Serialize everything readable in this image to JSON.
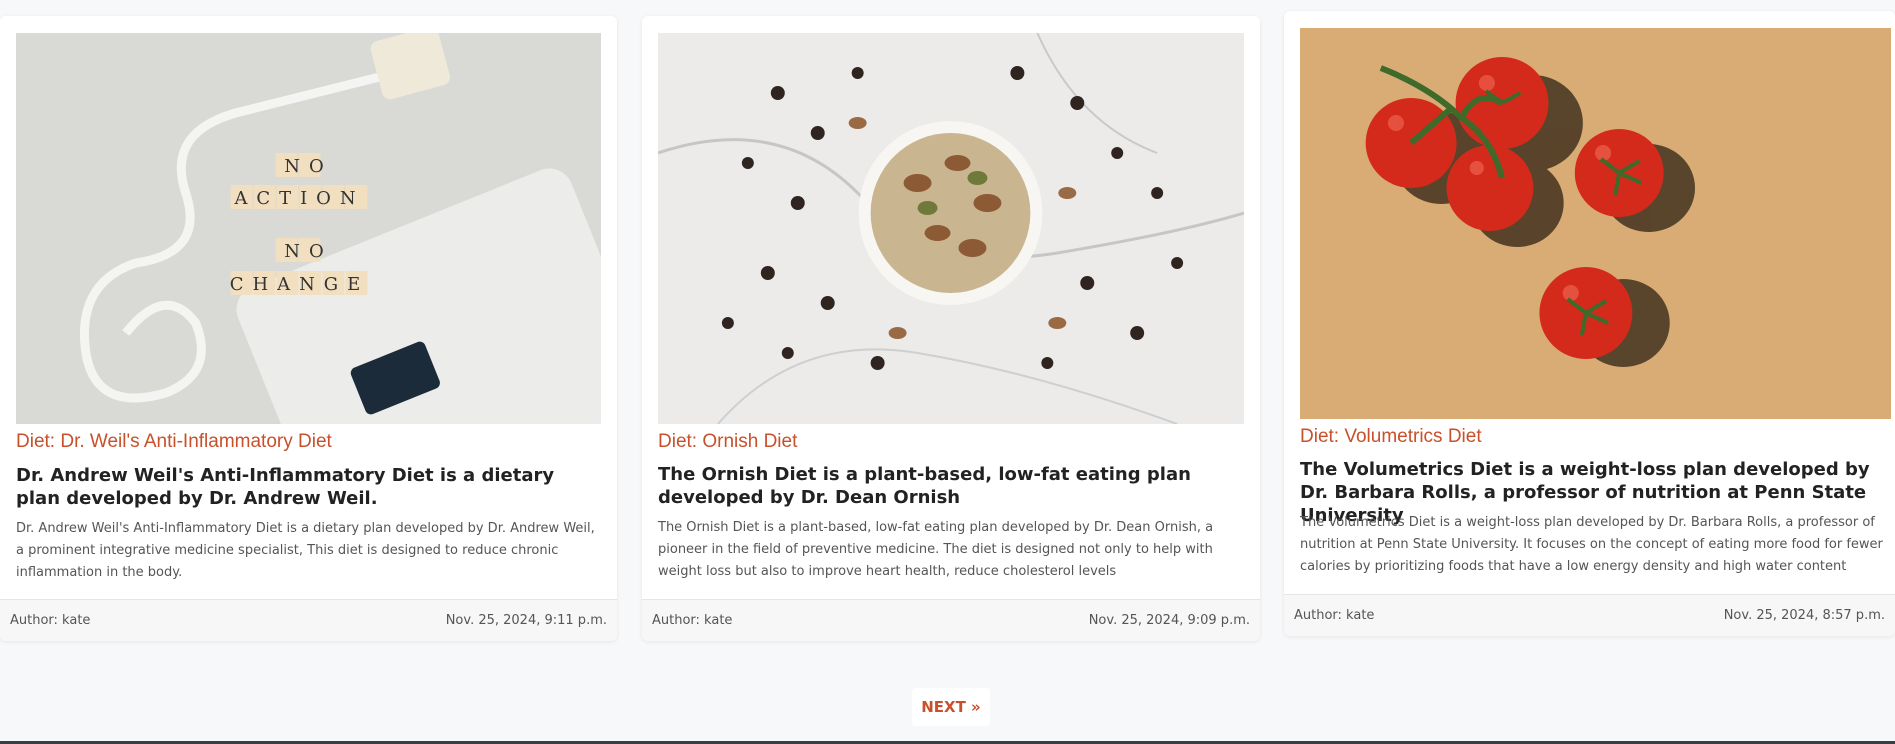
{
  "posts": [
    {
      "category": "Diet: Dr. Weil's Anti-Inflammatory Diet",
      "title": "Dr. Andrew Weil's Anti-Inflammatory Diet is a dietary plan developed by Dr. Andrew Weil.",
      "excerpt": "Dr. Andrew Weil's Anti-Inflammatory Diet is a dietary plan developed by Dr. Andrew Weil, a prominent integrative medicine specialist, This diet is designed to reduce chronic inflammation in the body.",
      "author": "Author: kate",
      "date": "Nov. 25, 2024, 9:11 p.m.",
      "image": {
        "tiles_line1": "NO",
        "tiles_line2": "ACTION",
        "tiles_line3": "NO",
        "tiles_line4": "CHANGE"
      }
    },
    {
      "category": "Diet: Ornish Diet",
      "title": "The Ornish Diet is a plant-based, low-fat eating plan developed by Dr. Dean Ornish",
      "excerpt": "The Ornish Diet is a plant-based, low-fat eating plan developed by Dr. Dean Ornish, a pioneer in the field of preventive medicine. The diet is designed not only to help with weight loss but also to improve heart health, reduce cholesterol levels",
      "author": "Author: kate",
      "date": "Nov. 25, 2024, 9:09 p.m."
    },
    {
      "category": "Diet: Volumetrics Diet",
      "title": "The Volumetrics Diet is a weight-loss plan developed by Dr. Barbara Rolls, a professor of nutrition at Penn State University",
      "excerpt": "The Volumetrics Diet is a weight-loss plan developed by Dr. Barbara Rolls, a professor of nutrition at Penn State University. It focuses on the concept of eating more food for fewer calories by prioritizing foods that have a low energy density and high water content",
      "author": "Author: kate",
      "date": "Nov. 25, 2024, 8:57 p.m."
    }
  ],
  "pagination": {
    "next_label": "NEXT »"
  },
  "colors": {
    "accent": "#c8502a",
    "background": "#f7f8fa"
  }
}
